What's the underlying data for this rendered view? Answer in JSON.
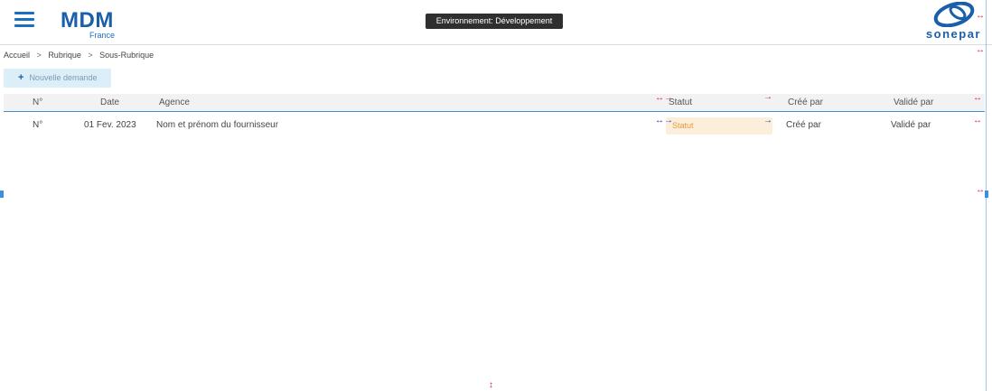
{
  "header": {
    "menu_icon": "hamburger-menu-icon",
    "logo_main": "MDM",
    "logo_sub": "France",
    "environment": "Environnement: Développement",
    "brand_name": "sonepar",
    "brand_icon": "sonepar-logo-icon"
  },
  "breadcrumb": {
    "items": [
      "Accueil",
      "Rubrique",
      "Sous-Rubrique"
    ],
    "separator": ">"
  },
  "toolbar": {
    "new_label": "Nouvelle demande",
    "new_icon": "plus-icon"
  },
  "table": {
    "columns": [
      "N°",
      "Date",
      "Agence",
      "Statut",
      "Créé par",
      "Validé par"
    ],
    "rows": [
      {
        "num": "N°",
        "date": "01 Fev. 2023",
        "agence": "Nom et prénom du fournisseur",
        "statut": "Statut",
        "cree_par": "Créé par",
        "valide_par": "Validé par"
      }
    ]
  },
  "colors": {
    "brand_blue": "#1a5fa8",
    "env_badge_bg": "#2f2f2f",
    "new_button_bg": "#dceef8",
    "status_bg": "#fbeedb",
    "status_text": "#e89a3c",
    "header_border": "#4a90c8"
  }
}
